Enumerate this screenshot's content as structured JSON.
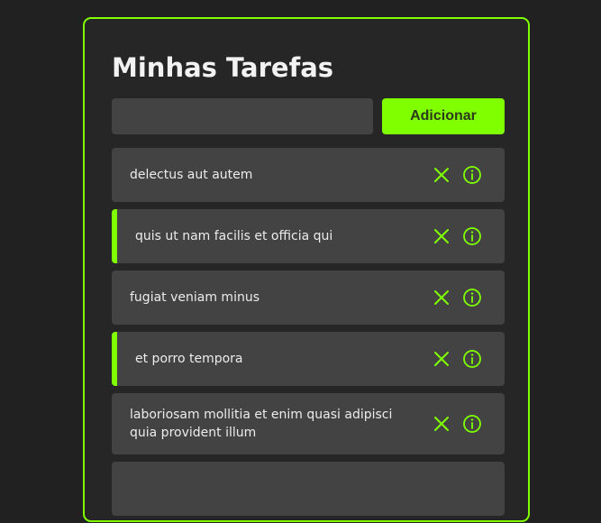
{
  "page": {
    "title": "Minhas Tarefas"
  },
  "form": {
    "input_value": "",
    "input_placeholder": "",
    "add_label": "Adicionar"
  },
  "colors": {
    "accent": "#7FFF00",
    "background": "#212121",
    "item_background": "#434343",
    "text": "#ececec"
  },
  "tasks": [
    {
      "text": "delectus aut autem",
      "flagged": false
    },
    {
      "text": "quis ut nam facilis et officia qui",
      "flagged": true
    },
    {
      "text": "fugiat veniam minus",
      "flagged": false
    },
    {
      "text": "et porro tempora",
      "flagged": true
    },
    {
      "text": "laboriosam mollitia et enim quasi adipisci quia provident illum",
      "flagged": false
    }
  ],
  "icons": {
    "delete": "close-icon",
    "info": "info-icon"
  }
}
